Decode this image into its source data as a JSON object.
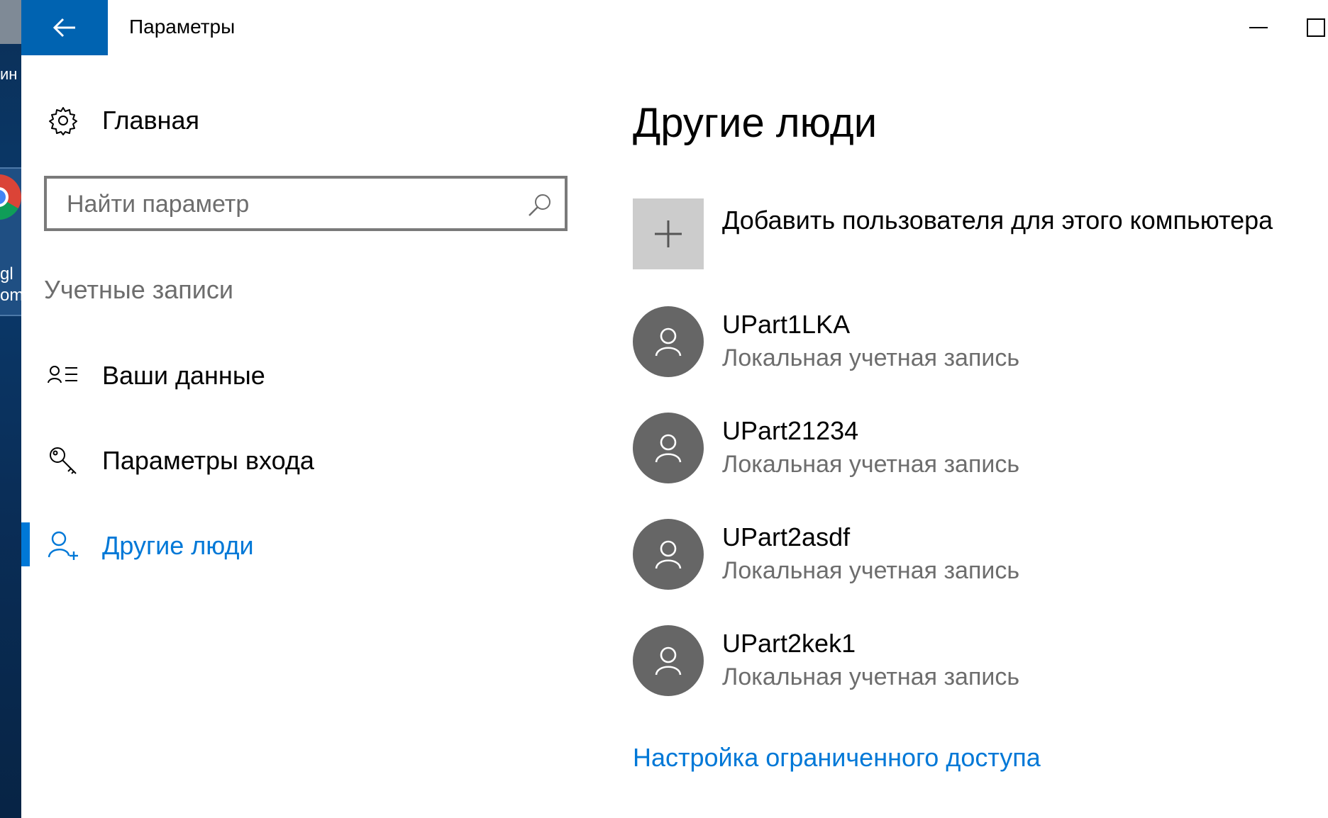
{
  "window": {
    "title": "Параметры"
  },
  "desktop": {
    "fragment_top": "ин",
    "fragment_bottom_1": "gl",
    "fragment_bottom_2": "om"
  },
  "sidebar": {
    "home_label": "Главная",
    "search_placeholder": "Найти параметр",
    "section_label": "Учетные записи",
    "items": [
      {
        "label": "Ваши данные",
        "icon": "contact-info-icon"
      },
      {
        "label": "Параметры входа",
        "icon": "key-icon"
      },
      {
        "label": "Другие люди",
        "icon": "add-person-icon",
        "active": true
      }
    ]
  },
  "main": {
    "title": "Другие люди",
    "add_user_label": "Добавить пользователя для этого компьютера",
    "users": [
      {
        "name": "UPart1LKA",
        "type": "Локальная учетная запись"
      },
      {
        "name": "UPart21234",
        "type": "Локальная учетная запись"
      },
      {
        "name": "UPart2asdf",
        "type": "Локальная учетная запись"
      },
      {
        "name": "UPart2kek1",
        "type": "Локальная учетная запись"
      }
    ],
    "restricted_access_link": "Настройка ограниченного доступа"
  },
  "colors": {
    "accent": "#0078d7",
    "back_button": "#0063b1",
    "avatar": "#666666",
    "add_tile": "#cccccc",
    "secondary_text": "#6d6d6d"
  }
}
